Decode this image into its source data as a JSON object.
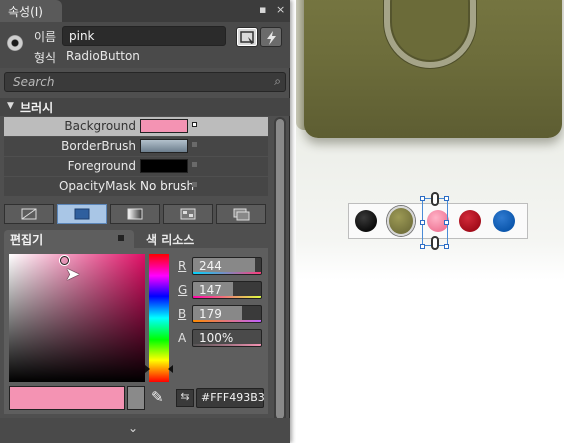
{
  "panel": {
    "tab_label": "속성(I)",
    "pin_glyph": "▪",
    "close_glyph": "×",
    "name_label": "이름",
    "name_value": "pink",
    "type_label": "형식",
    "type_value": "RadioButton",
    "search_placeholder": "Search",
    "section_expander": "▼",
    "section_title": "브러시"
  },
  "brushes": [
    {
      "name": "Background",
      "color": "#F493B3"
    },
    {
      "name": "BorderBrush",
      "color": "#8A9BAA"
    },
    {
      "name": "Foreground",
      "color": "#000000"
    },
    {
      "name": "OpacityMask",
      "value": "No brush"
    }
  ],
  "brush_types": [
    "no-brush",
    "solid-color",
    "gradient",
    "tile-brush",
    "resource"
  ],
  "editor": {
    "editor_tab": "편집기",
    "resources_tab": "색 리소스",
    "channels": [
      {
        "label": "R",
        "value": "244"
      },
      {
        "label": "G",
        "value": "147"
      },
      {
        "label": "B",
        "value": "179"
      },
      {
        "label": "A",
        "value": "100%"
      }
    ],
    "hex": "#FFF493B3",
    "selected_color": "#F493B3"
  },
  "artboard": {
    "swatches": [
      "#111111",
      "#8A8746",
      "#F493B3",
      "#BF1020",
      "#1D66BD"
    ],
    "selected_swatch": 2
  },
  "footer": {
    "expand_glyph": "⌄"
  }
}
